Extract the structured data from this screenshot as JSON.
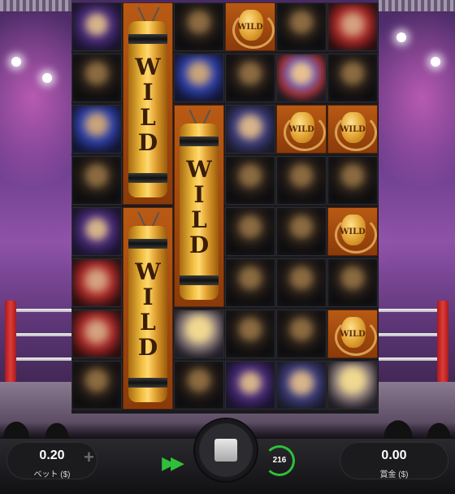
{
  "game": {
    "bet": {
      "value": "0.20",
      "label": "ベット ($)"
    },
    "win": {
      "value": "0.00",
      "label": "賞金 ($)"
    },
    "autoplay_count": "216",
    "wild_text": "WILD",
    "tall_wild_letters": [
      "W",
      "I",
      "L",
      "D"
    ],
    "plus_symbol": "+",
    "fast_forward_symbol": "▶▶"
  },
  "reels": [
    [
      "purple",
      "dark",
      "blue",
      "dark",
      "purple",
      "red",
      "red",
      "dark"
    ],
    [
      "tall-wild-rows-0-3",
      "tall-wild-rows-4-7"
    ],
    [
      "dark",
      "blue",
      "tall-wild-rows-2-5",
      "blonde",
      "dark"
    ],
    [
      "wild",
      "dark",
      "bluemix",
      "dark",
      "dark",
      "dark",
      "dark",
      "purple"
    ],
    [
      "dark",
      "mix",
      "wild",
      "dark",
      "dark",
      "dark",
      "dark",
      "bluemix"
    ],
    [
      "red",
      "dark",
      "wild",
      "dark",
      "wild",
      "dark",
      "wild",
      "blonde"
    ]
  ]
}
